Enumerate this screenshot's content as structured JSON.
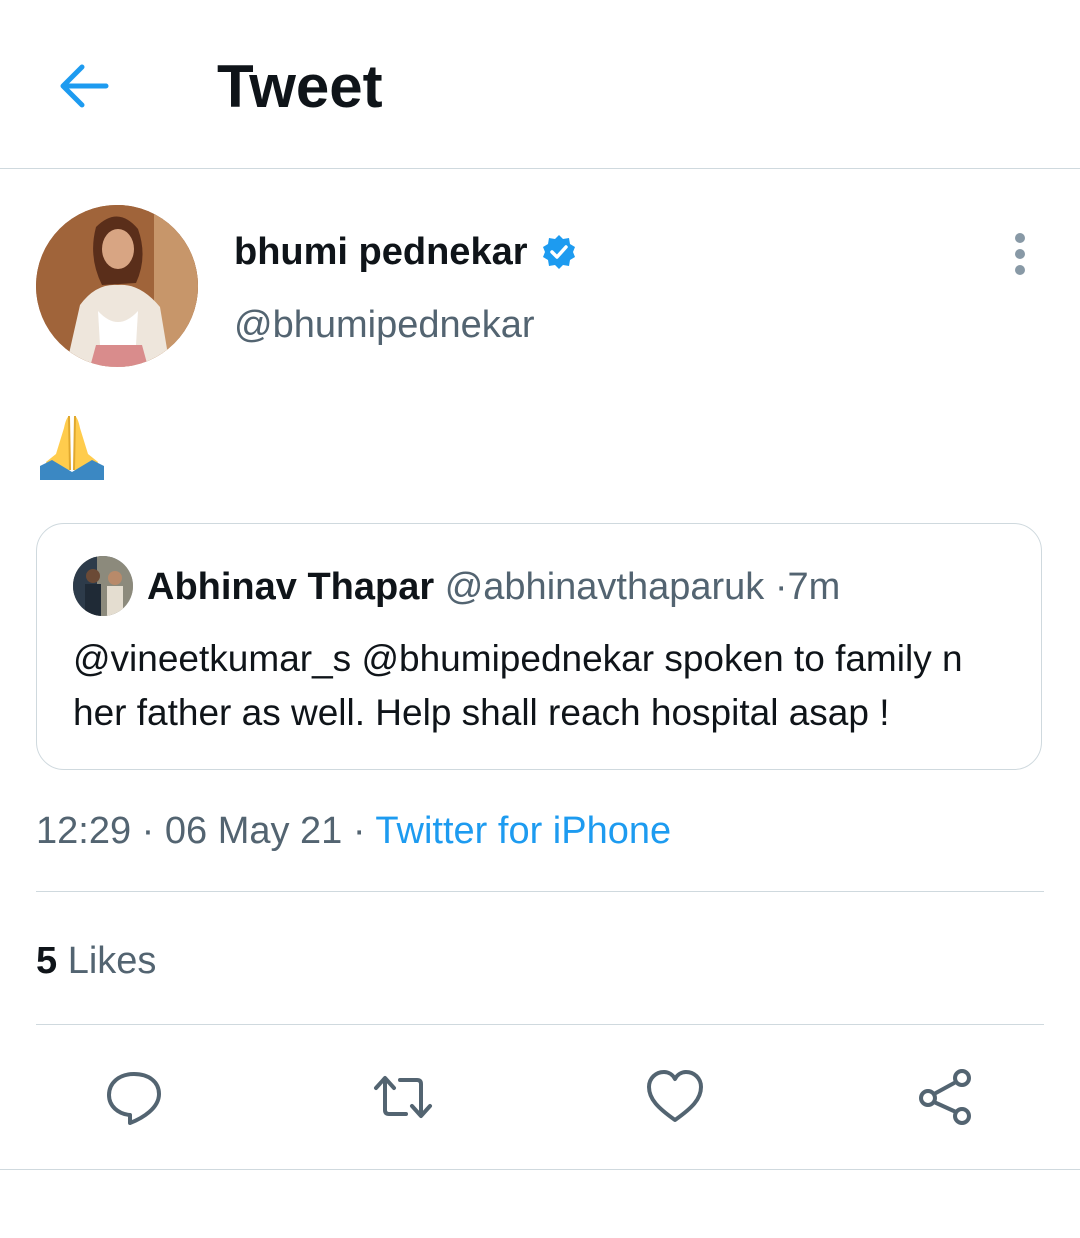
{
  "header": {
    "title": "Tweet",
    "back_icon": "arrow-left-icon",
    "accent": "#1d9bf0"
  },
  "tweet": {
    "author_name": "bhumi pednekar",
    "author_handle": "@bhumipednekar",
    "verified": true,
    "content_emoji": "folded-hands-emoji",
    "quoted": {
      "author_name": "Abhinav Thapar",
      "author_handle": "@abhinavthaparuk",
      "age": "7m",
      "text": "@vineetkumar_s @bhumipednekar spoken to family n her father as well. Help shall reach hospital asap !"
    },
    "time": "12:29",
    "date": "06 May 21",
    "source": "Twitter for iPhone",
    "likes_count": "5",
    "likes_label": "Likes"
  },
  "actions": [
    "reply-icon",
    "retweet-icon",
    "like-icon",
    "share-icon"
  ]
}
